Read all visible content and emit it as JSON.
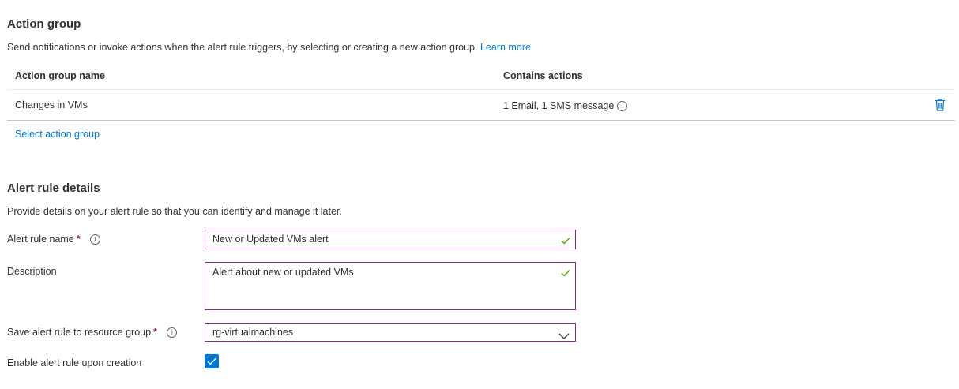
{
  "action_group": {
    "title": "Action group",
    "description": "Send notifications or invoke actions when the alert rule triggers, by selecting or creating a new action group.",
    "learn_more": "Learn more",
    "table": {
      "columns": [
        "Action group name",
        "Contains actions"
      ],
      "rows": [
        {
          "name": "Changes in VMs",
          "actions": "1 Email, 1 SMS message"
        }
      ]
    },
    "select_link": "Select action group"
  },
  "alert_rule_details": {
    "title": "Alert rule details",
    "description": "Provide details on your alert rule so that you can identify and manage it later.",
    "name_label": "Alert rule name",
    "name_value": "New or Updated VMs alert",
    "description_label": "Description",
    "description_value": "Alert about new or updated VMs",
    "resource_group_label": "Save alert rule to resource group",
    "resource_group_value": "rg-virtualmachines",
    "enable_label": "Enable alert rule upon creation",
    "enable_checked": true,
    "required_mark": "*"
  },
  "colors": {
    "accent": "#0078d4",
    "field_border": "#8a2a8f",
    "valid_check": "#57a300",
    "required": "#a4262c"
  }
}
